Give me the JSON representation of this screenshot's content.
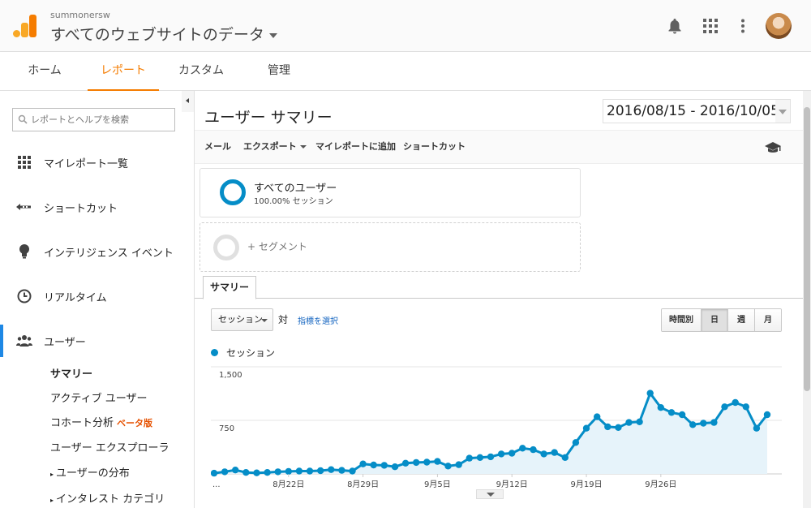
{
  "header": {
    "account": "summonersw",
    "property": "すべてのウェブサイトのデータ"
  },
  "nav": {
    "tabs": [
      {
        "label": "ホーム"
      },
      {
        "label": "レポート"
      },
      {
        "label": "カスタム"
      },
      {
        "label": "管理"
      }
    ]
  },
  "sidebar": {
    "search_placeholder": "レポートとヘルプを検索",
    "items": [
      {
        "label": "マイレポート一覧"
      },
      {
        "label": "ショートカット"
      },
      {
        "label": "インテリジェンス イベント"
      },
      {
        "label": "リアルタイム"
      },
      {
        "label": "ユーザー"
      }
    ],
    "subitems": [
      {
        "label": "サマリー"
      },
      {
        "label": "アクティブ ユーザー"
      },
      {
        "label": "コホート分析"
      },
      {
        "label": "ユーザー エクスプローラ"
      },
      {
        "label": "ユーザーの分布"
      },
      {
        "label": "インタレスト カテゴリ"
      }
    ],
    "beta_label": "ベータ版"
  },
  "main": {
    "title": "ユーザー サマリー",
    "date_range": "2016/08/15 - 2016/10/05",
    "toolbar": {
      "mail": "メール",
      "export": "エクスポート",
      "add_dashboard": "マイレポートに追加",
      "shortcut": "ショートカット"
    },
    "segment": {
      "name": "すべてのユーザー",
      "share": "100.00% セッション",
      "add": "+ セグメント"
    },
    "tab": "サマリー",
    "metric": "セッション",
    "vs": "対",
    "choose_metric": "指標を選択",
    "granularity": [
      {
        "label": "時間別"
      },
      {
        "label": "日"
      },
      {
        "label": "週"
      },
      {
        "label": "月"
      }
    ],
    "granularity_selected": "日",
    "legend": "セッション"
  },
  "colors": {
    "accent": "#f57c00",
    "series": "#058dc7",
    "area": "#e6f3fa",
    "active_bar": "#1e88e5"
  },
  "chart_data": {
    "type": "area",
    "series": [
      {
        "name": "セッション",
        "values": [
          10,
          30,
          55,
          20,
          15,
          20,
          30,
          35,
          40,
          40,
          45,
          60,
          50,
          40,
          140,
          125,
          120,
          100,
          150,
          160,
          165,
          175,
          110,
          130,
          220,
          230,
          240,
          280,
          290,
          360,
          340,
          280,
          300,
          230,
          440,
          640,
          800,
          660,
          650,
          720,
          730,
          1130,
          930,
          860,
          830,
          690,
          710,
          720,
          940,
          1000,
          940,
          640,
          830
        ]
      }
    ],
    "x_tick_labels": [
      "...",
      "8月22日",
      "8月29日",
      "9月5日",
      "9月12日",
      "9月19日",
      "9月26日"
    ],
    "x_tick_index": [
      0,
      7,
      14,
      21,
      28,
      35,
      42
    ],
    "y_tick_labels": [
      "1,500",
      "750"
    ],
    "ylim": [
      0,
      1500
    ],
    "grid": true
  }
}
